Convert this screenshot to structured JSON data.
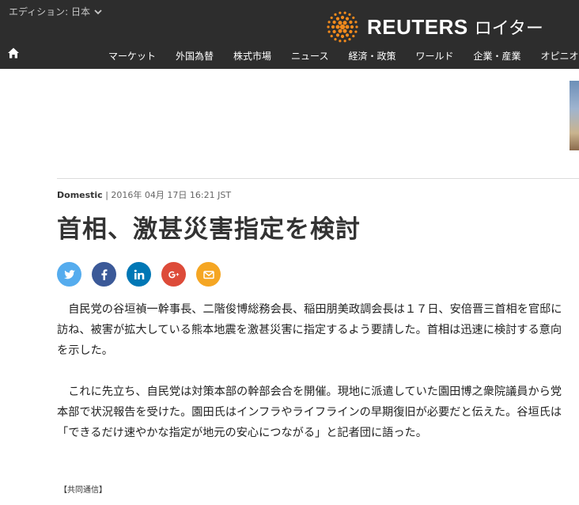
{
  "header": {
    "edition_label": "エディション: 日本",
    "brand_name": "REUTERS",
    "brand_jp": "ロイター",
    "brand_color": "#f28a1c",
    "nav_items": [
      "マーケット",
      "外国為替",
      "株式市場",
      "ニュース",
      "経済・政策",
      "ワールド",
      "企業・産業",
      "オピニオン"
    ]
  },
  "article": {
    "category": "Domestic",
    "timestamp": "| 2016年 04月 17日 16:21 JST",
    "headline": "首相、激甚災害指定を検討",
    "paragraphs": [
      "自民党の谷垣禎一幹事長、二階俊博総務会長、稲田朋美政調会長は１７日、安倍晋三首相を官邸に訪ね、被害が拡大している熊本地震を激甚災害に指定するよう要請した。首相は迅速に検討する意向を示した。",
      "これに先立ち、自民党は対策本部の幹部会合を開催。現地に派遣していた園田博之衆院議員から党本部で状況報告を受けた。園田氏はインフラやライフラインの早期復旧が必要だと伝えた。谷垣氏は「できるだけ速やかな指定が地元の安心につながる」と記者団に語った。"
    ],
    "credit": "【共同通信】"
  },
  "share_buttons": [
    {
      "icon": "twitter-icon",
      "color": "#55acee"
    },
    {
      "icon": "facebook-icon",
      "color": "#3b5998"
    },
    {
      "icon": "linkedin-icon",
      "color": "#0077b5"
    },
    {
      "icon": "google-plus-icon",
      "color": "#dd4b39"
    },
    {
      "icon": "email-icon",
      "color": "#f5a623"
    }
  ]
}
